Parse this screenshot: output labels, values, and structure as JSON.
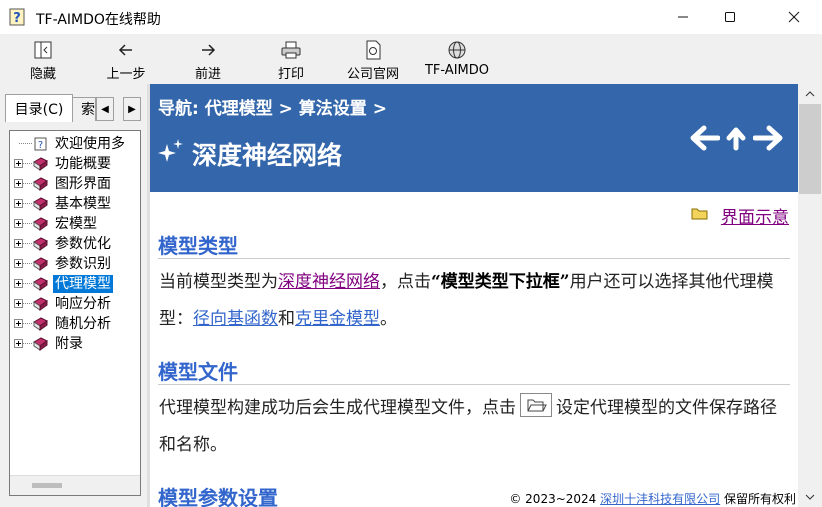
{
  "window": {
    "title": "TF-AIMDO在线帮助",
    "controls": [
      "minimize",
      "maximize",
      "close"
    ]
  },
  "toolbar": {
    "buttons": [
      {
        "label": "隐藏",
        "icon": "hide-icon"
      },
      {
        "label": "上一步",
        "icon": "back-arrow-icon"
      },
      {
        "label": "前进",
        "icon": "forward-arrow-icon"
      },
      {
        "label": "打印",
        "icon": "printer-icon"
      },
      {
        "label": "公司官网",
        "icon": "web-page-icon"
      },
      {
        "label": "TF-AIMDO",
        "icon": "globe-icon"
      }
    ]
  },
  "sidebar": {
    "tabs": [
      {
        "label": "目录(C)",
        "active": true
      },
      {
        "label": "索",
        "active": false
      }
    ],
    "tree": [
      {
        "label": "欢迎使用多",
        "icon": "help-page-icon",
        "expandable": false,
        "selected": false
      },
      {
        "label": "功能概要",
        "icon": "book-icon",
        "expandable": true,
        "selected": false
      },
      {
        "label": "图形界面",
        "icon": "book-icon",
        "expandable": true,
        "selected": false
      },
      {
        "label": "基本模型",
        "icon": "book-icon",
        "expandable": true,
        "selected": false
      },
      {
        "label": "宏模型",
        "icon": "book-icon",
        "expandable": true,
        "selected": false
      },
      {
        "label": "参数优化",
        "icon": "book-icon",
        "expandable": true,
        "selected": false
      },
      {
        "label": "参数识别",
        "icon": "book-icon",
        "expandable": true,
        "selected": false
      },
      {
        "label": "代理模型",
        "icon": "book-icon",
        "expandable": true,
        "selected": true
      },
      {
        "label": "响应分析",
        "icon": "book-icon",
        "expandable": true,
        "selected": false
      },
      {
        "label": "随机分析",
        "icon": "book-icon",
        "expandable": true,
        "selected": false
      },
      {
        "label": "附录",
        "icon": "book-icon",
        "expandable": true,
        "selected": false
      }
    ]
  },
  "content": {
    "breadcrumb": "导航: 代理模型 > 算法设置 >",
    "page_title": "深度神经网络",
    "ui_link": "界面示意",
    "sections": [
      {
        "title": "模型类型",
        "p1_a": "当前模型类型为",
        "link1": "深度神经网络",
        "p1_b": "，点击",
        "bold": "“模型类型下拉框”",
        "p1_c": "用户还可以选择其他代理模型：",
        "link2": "径向基函数",
        "p1_d": "和",
        "link3": "克里金模型",
        "p1_e": "。"
      },
      {
        "title": "模型文件",
        "p_a": "代理模型构建成功后会生成代理模型文件，点击",
        "p_b": "设定代理模型的文件保存路径和名称。"
      },
      {
        "title": "模型参数设置"
      }
    ],
    "footer": {
      "copyright": "© 2023~2024",
      "company": "深圳十沣科技有限公司",
      "rights": "保留所有权利"
    }
  },
  "colors": {
    "header_bg": "#3366aa",
    "section_title": "#3366cc",
    "visited_link": "#800080",
    "selection": "#0078d7"
  }
}
